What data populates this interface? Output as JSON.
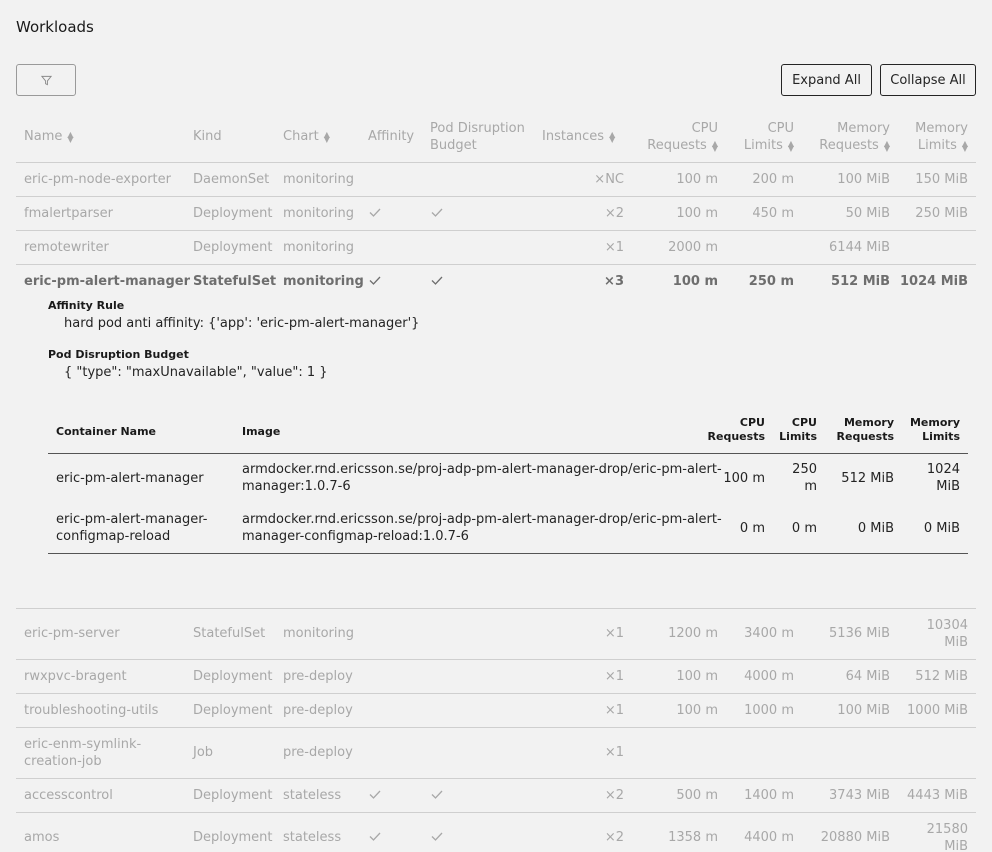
{
  "page": {
    "title": "Workloads"
  },
  "toolbar": {
    "expand_all": "Expand All",
    "collapse_all": "Collapse All"
  },
  "columns": {
    "name": "Name",
    "kind": "Kind",
    "chart": "Chart",
    "affinity": "Affinity",
    "pdb_1": "Pod Disruption",
    "pdb_2": "Budget",
    "instances": "Instances",
    "cpu_req_1": "CPU",
    "cpu_req_2": "Requests",
    "cpu_lim_1": "CPU",
    "cpu_lim_2": "Limits",
    "mem_req_1": "Memory",
    "mem_req_2": "Requests",
    "mem_lim_1": "Memory",
    "mem_lim_2": "Limits"
  },
  "rows_top": [
    {
      "name": "eric-pm-node-exporter",
      "kind": "DaemonSet",
      "chart": "monitoring",
      "affinity": false,
      "pdb": false,
      "instances": "×NC",
      "cpu_req": "100 m",
      "cpu_lim": "200 m",
      "mem_req": "100 MiB",
      "mem_lim": "150 MiB"
    },
    {
      "name": "fmalertparser",
      "kind": "Deployment",
      "chart": "monitoring",
      "affinity": true,
      "pdb": true,
      "instances": "×2",
      "cpu_req": "100 m",
      "cpu_lim": "450 m",
      "mem_req": "50 MiB",
      "mem_lim": "250 MiB"
    },
    {
      "name": "remotewriter",
      "kind": "Deployment",
      "chart": "monitoring",
      "affinity": false,
      "pdb": false,
      "instances": "×1",
      "cpu_req": "2000 m",
      "cpu_lim": "",
      "mem_req": "6144 MiB",
      "mem_lim": ""
    },
    {
      "name": "eric-pm-alert-manager",
      "kind": "StatefulSet",
      "chart": "monitoring",
      "affinity": true,
      "pdb": true,
      "instances": "×3",
      "cpu_req": "100 m",
      "cpu_lim": "250 m",
      "mem_req": "512 MiB",
      "mem_lim": "1024 MiB"
    }
  ],
  "details": {
    "affinity_label": "Affinity Rule",
    "affinity_value": "hard pod anti affinity: {'app': 'eric-pm-alert-manager'}",
    "pdb_label": "Pod Disruption Budget",
    "pdb_value": "{ \"type\": \"maxUnavailable\", \"value\": 1 }"
  },
  "containers": {
    "headers": {
      "name": "Container Name",
      "image": "Image",
      "cpu_req_1": "CPU",
      "cpu_req_2": "Requests",
      "cpu_lim_1": "CPU",
      "cpu_lim_2": "Limits",
      "mem_req_1": "Memory",
      "mem_req_2": "Requests",
      "mem_lim_1": "Memory",
      "mem_lim_2": "Limits"
    },
    "rows": [
      {
        "name_1": "eric-pm-alert-manager",
        "name_2": "",
        "image_1": "armdocker.rnd.ericsson.se/proj-adp-pm-alert-manager-drop/eric-pm-alert-",
        "image_2": "manager:1.0.7-6",
        "cpu_req": "100 m",
        "cpu_lim_1": "250",
        "cpu_lim_2": "m",
        "mem_req": "512 MiB",
        "mem_lim_1": "1024",
        "mem_lim_2": "MiB"
      },
      {
        "name_1": "eric-pm-alert-manager-",
        "name_2": "configmap-reload",
        "image_1": "armdocker.rnd.ericsson.se/proj-adp-pm-alert-manager-drop/eric-pm-alert-",
        "image_2": "manager-configmap-reload:1.0.7-6",
        "cpu_req": "0 m",
        "cpu_lim_1": "0 m",
        "cpu_lim_2": "",
        "mem_req": "0 MiB",
        "mem_lim_1": "0 MiB",
        "mem_lim_2": ""
      }
    ]
  },
  "rows_bottom": [
    {
      "name_1": "eric-pm-server",
      "name_2": "",
      "kind": "StatefulSet",
      "chart": "monitoring",
      "affinity": false,
      "pdb": false,
      "instances": "×1",
      "cpu_req": "1200 m",
      "cpu_lim": "3400 m",
      "mem_req": "5136 MiB",
      "mem_lim_1": "10304",
      "mem_lim_2": "MiB"
    },
    {
      "name_1": "rwxpvc-bragent",
      "name_2": "",
      "kind": "Deployment",
      "chart": "pre-deploy",
      "affinity": false,
      "pdb": false,
      "instances": "×1",
      "cpu_req": "100 m",
      "cpu_lim": "4000 m",
      "mem_req": "64 MiB",
      "mem_lim_1": "512 MiB",
      "mem_lim_2": ""
    },
    {
      "name_1": "troubleshooting-utils",
      "name_2": "",
      "kind": "Deployment",
      "chart": "pre-deploy",
      "affinity": false,
      "pdb": false,
      "instances": "×1",
      "cpu_req": "100 m",
      "cpu_lim": "1000 m",
      "mem_req": "100 MiB",
      "mem_lim_1": "1000 MiB",
      "mem_lim_2": ""
    },
    {
      "name_1": "eric-enm-symlink-",
      "name_2": "creation-job",
      "kind": "Job",
      "chart": "pre-deploy",
      "affinity": false,
      "pdb": false,
      "instances": "×1",
      "cpu_req": "",
      "cpu_lim": "",
      "mem_req": "",
      "mem_lim_1": "",
      "mem_lim_2": ""
    },
    {
      "name_1": "accesscontrol",
      "name_2": "",
      "kind": "Deployment",
      "chart": "stateless",
      "affinity": true,
      "pdb": true,
      "instances": "×2",
      "cpu_req": "500 m",
      "cpu_lim": "1400 m",
      "mem_req": "3743 MiB",
      "mem_lim_1": "4443 MiB",
      "mem_lim_2": ""
    },
    {
      "name_1": "amos",
      "name_2": "",
      "kind": "Deployment",
      "chart": "stateless",
      "affinity": true,
      "pdb": true,
      "instances": "×2",
      "cpu_req": "1358 m",
      "cpu_lim": "4400 m",
      "mem_req": "20880 MiB",
      "mem_lim_1": "21580",
      "mem_lim_2": "MiB"
    }
  ]
}
